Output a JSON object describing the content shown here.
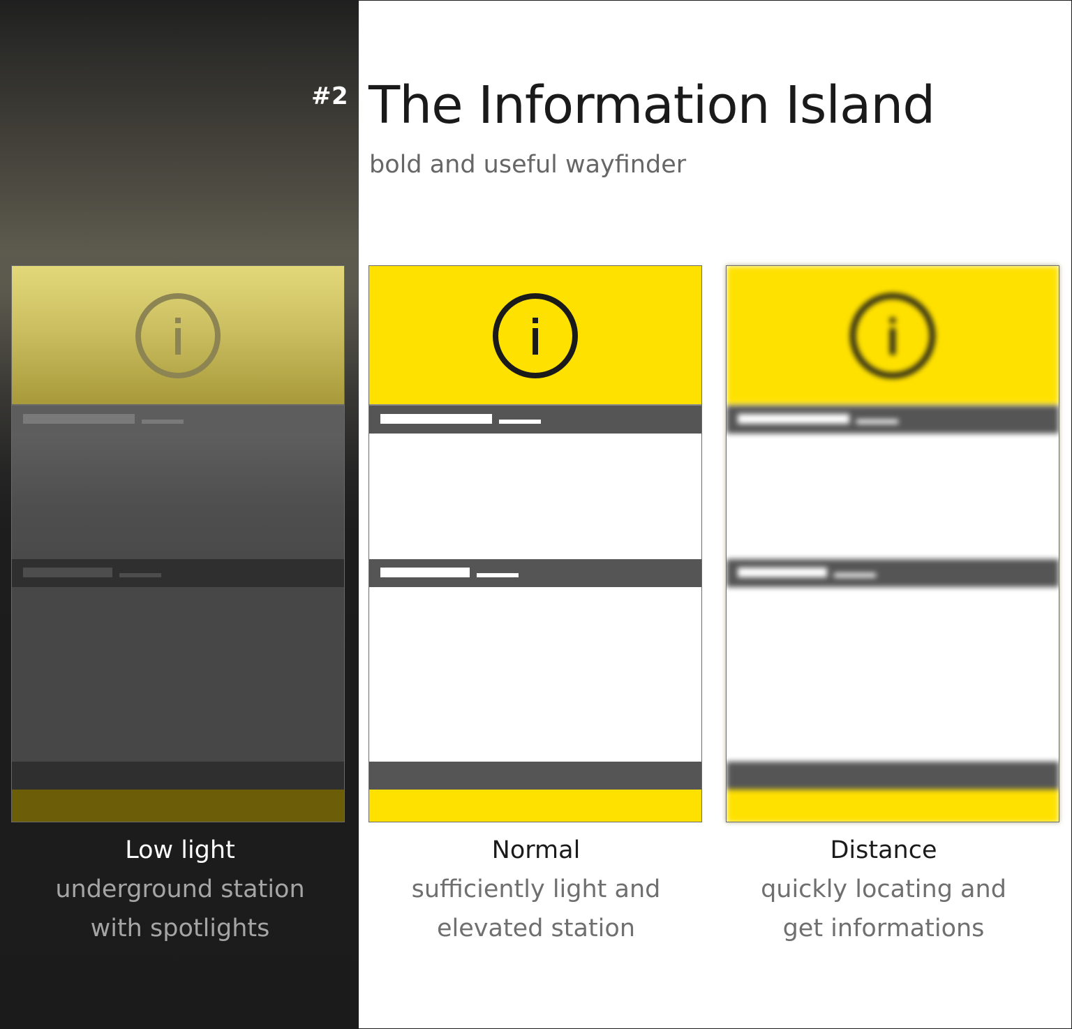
{
  "header": {
    "number": "#2",
    "title": "The Information Island",
    "subtitle": "bold and useful wayfinder"
  },
  "colors": {
    "sign_yellow": "#ffe100",
    "bar_gray": "#555555",
    "dark_background": "#1b1b1b",
    "text_dark": "#1a1a1a"
  },
  "icons": {
    "info": "info-circle-icon"
  },
  "variants": [
    {
      "title": "Low light",
      "description_line1": "underground station",
      "description_line2": "with spotlights"
    },
    {
      "title": "Normal",
      "description_line1": "sufficiently light and",
      "description_line2": "elevated station"
    },
    {
      "title": "Distance",
      "description_line1": "quickly locating and",
      "description_line2": "get informations"
    }
  ]
}
